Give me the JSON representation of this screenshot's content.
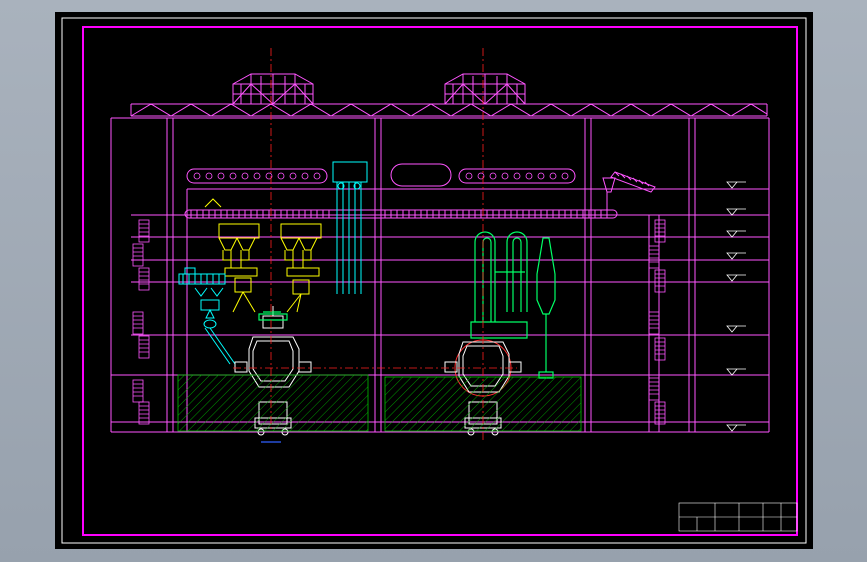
{
  "app": {
    "title": "",
    "background": "#a0a9b4"
  },
  "drawing": {
    "background": "#000000",
    "colors": {
      "frame": "#ff00ff",
      "border": "#ffffff",
      "equipment": "#ffffff",
      "center_line": "#ff2020",
      "conveyor": "#ff55ff",
      "hopper": "#ffff00",
      "feeder": "#00ffff",
      "ducts": "#00ff66",
      "hatch": "#00ff00"
    },
    "annotations": {
      "blue_label": "",
      "converter_left": "",
      "converter_right": ""
    },
    "elevation_marks": [
      "",
      "",
      "",
      "",
      "",
      "",
      "",
      ""
    ],
    "title_block": {
      "row1": [
        "",
        "",
        "",
        "",
        "",
        ""
      ],
      "row2": [
        "",
        "",
        ""
      ]
    }
  }
}
